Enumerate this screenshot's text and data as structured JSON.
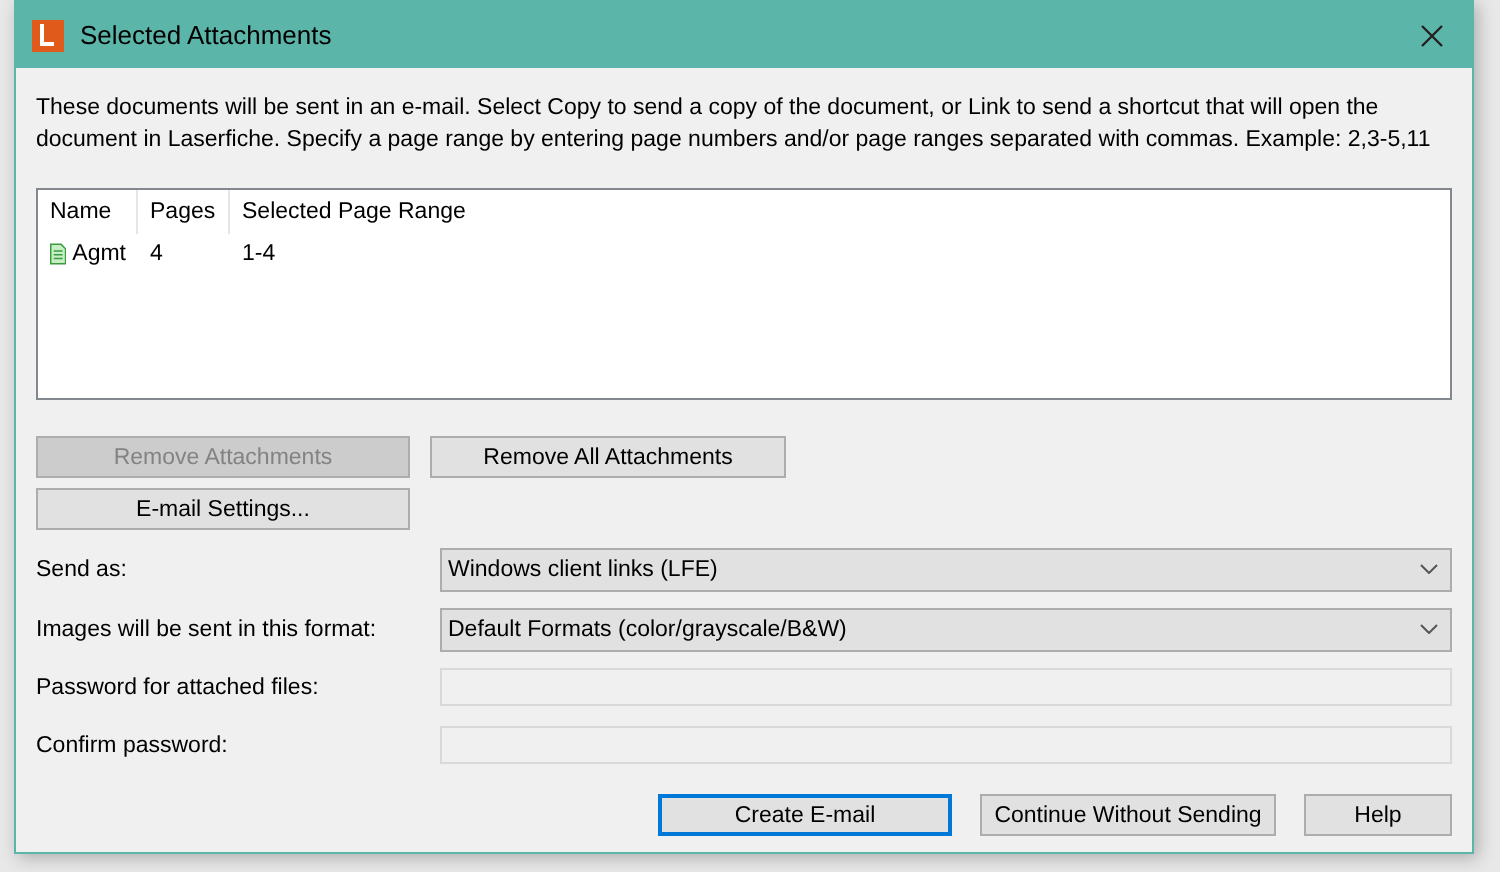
{
  "window": {
    "title": "Selected Attachments"
  },
  "description": "These documents will be sent in an e-mail. Select Copy to send a copy of the document, or Link to send a shortcut that will open the document in Laserfiche.  Specify a page range by entering page numbers and/or page ranges separated with commas.  Example: 2,3-5,11",
  "table": {
    "columns": [
      "Name",
      "Pages",
      "Selected Page Range"
    ],
    "rows": [
      {
        "name": "Agmt",
        "pages": "4",
        "range": "1-4",
        "selected": false
      }
    ]
  },
  "action_buttons": [
    {
      "label": "Remove Attachments",
      "disabled": true
    },
    {
      "label": "Remove All Attachments",
      "disabled": false
    },
    {
      "label": "E-mail Settings...",
      "disabled": false
    }
  ],
  "form": [
    {
      "kind": "select",
      "label": "Send as:",
      "value": "Windows client links (LFE)"
    },
    {
      "kind": "select",
      "label": "Images will be sent in this format:",
      "value": "Default Formats (color/grayscale/B&W)"
    },
    {
      "kind": "password",
      "label": "Password for attached files:",
      "disabled": true
    },
    {
      "kind": "password",
      "label": "Confirm password:",
      "disabled": true
    }
  ],
  "footer_buttons": [
    {
      "label": "Create E-mail",
      "default": true
    },
    {
      "label": "Continue Without Sending",
      "default": false
    },
    {
      "label": "Help",
      "default": false
    }
  ]
}
